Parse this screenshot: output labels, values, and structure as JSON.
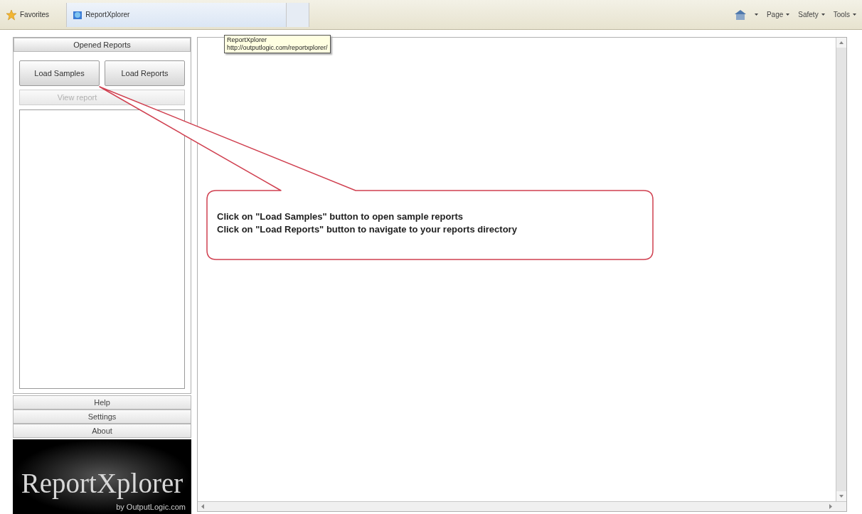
{
  "toolbar": {
    "favorites": "Favorites",
    "tab": {
      "title": "ReportXplorer",
      "selected": true
    },
    "commands": [
      "Page",
      "Safety",
      "Tools"
    ]
  },
  "tooltip": {
    "title": "ReportXplorer",
    "url": "http://outputlogic.com/reportxplorer/"
  },
  "sidebar": {
    "sections": [
      {
        "label": "Opened Reports",
        "expanded": true
      },
      {
        "label": "Help",
        "expanded": false
      },
      {
        "label": "Settings",
        "expanded": false
      },
      {
        "label": "About",
        "expanded": false
      }
    ],
    "buttons": [
      {
        "label": "Load Samples",
        "disabled": false
      },
      {
        "label": "Load Reports",
        "disabled": false
      }
    ],
    "summary_button": {
      "label": "View report",
      "disabled": true
    },
    "logo": {
      "title": "ReportXplorer",
      "byline": "by OutputLogic.com"
    }
  },
  "callout": {
    "lines": [
      "Click on \"Load Samples\" button to open sample reports",
      "Click on \"Load Reports\" button to navigate to your reports directory"
    ]
  }
}
